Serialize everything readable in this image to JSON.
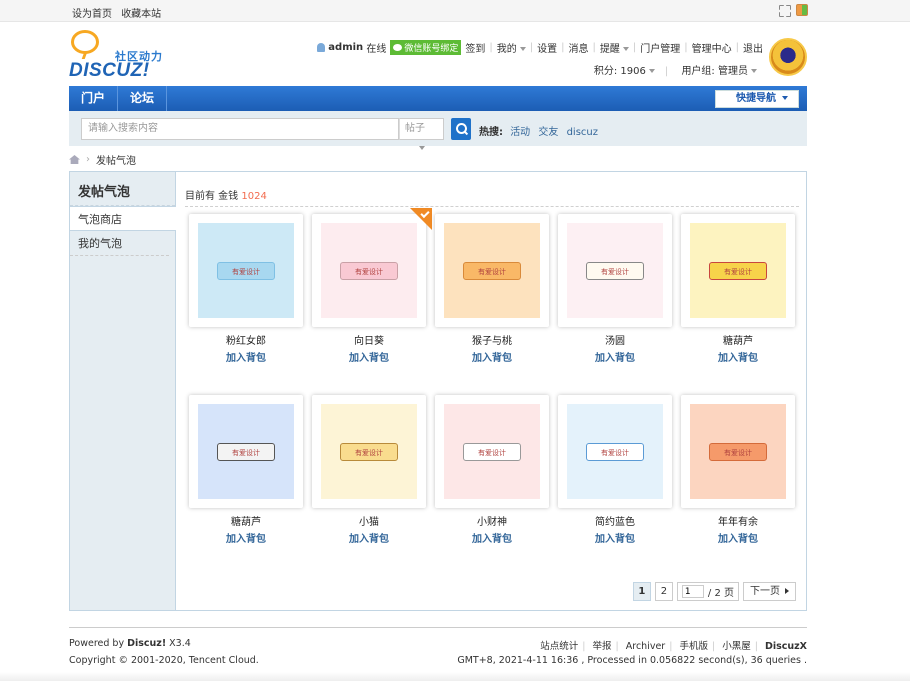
{
  "topbar": {
    "links": [
      "设为首页",
      "收藏本站"
    ]
  },
  "logo": {
    "cn": "社区动力",
    "en": "DISCUZ!"
  },
  "user": {
    "name": "admin",
    "online": "在线",
    "wechat": "微信账号绑定",
    "nav": [
      "签到",
      "我的",
      "设置",
      "消息",
      "提醒",
      "门户管理",
      "管理中心",
      "退出"
    ],
    "points": "积分: 1906",
    "group": "用户组: 管理员"
  },
  "nav": {
    "items": [
      "门户",
      "论坛"
    ],
    "quick": "快捷导航"
  },
  "search": {
    "placeholder": "请输入搜索内容",
    "type": "帖子",
    "hot_label": "热搜:",
    "hot": [
      "活动",
      "交友",
      "discuz"
    ]
  },
  "breadcrumb": {
    "current": "发帖气泡"
  },
  "sidebar": {
    "title": "发帖气泡",
    "items": [
      "气泡商店",
      "我的气泡"
    ]
  },
  "money": {
    "label": "目前有 金钱",
    "value": "1024"
  },
  "cards": [
    {
      "name": "粉红女郎",
      "bubble": "有爱设计",
      "action": "加入背包",
      "bg": "#cde9f6",
      "bcolor": "#a8d8f0",
      "bborder": "#7fc0e4"
    },
    {
      "name": "向日葵",
      "bubble": "有爱设计",
      "action": "加入背包",
      "bg": "#fdecef",
      "bcolor": "#f9c9d3",
      "bborder": "#c9a0a6"
    },
    {
      "name": "猴子与桃",
      "bubble": "有爱设计",
      "action": "加入背包",
      "bg": "#fde2be",
      "bcolor": "#f9b867",
      "bborder": "#d98a3a"
    },
    {
      "name": "汤圆",
      "bubble": "有爱设计",
      "action": "加入背包",
      "bg": "#fdf0f3",
      "bcolor": "#fffaf0",
      "bborder": "#888888"
    },
    {
      "name": "糖葫芦",
      "bubble": "有爱设计",
      "action": "加入背包",
      "bg": "#fdf3c0",
      "bcolor": "#f7d34a",
      "bborder": "#c9463d"
    },
    {
      "name": "糖葫芦",
      "bubble": "有爱设计",
      "action": "加入背包",
      "bg": "#d6e4fa",
      "bcolor": "#f3f3f3",
      "bborder": "#555555"
    },
    {
      "name": "小猫",
      "bubble": "有爱设计",
      "action": "加入背包",
      "bg": "#fdf4d6",
      "bcolor": "#f9dc8e",
      "bborder": "#b88a3a"
    },
    {
      "name": "小财神",
      "bubble": "有爱设计",
      "action": "加入背包",
      "bg": "#fde7e7",
      "bcolor": "#ffffff",
      "bborder": "#999999"
    },
    {
      "name": "简约蓝色",
      "bubble": "有爱设计",
      "action": "加入背包",
      "bg": "#e4f2fb",
      "bcolor": "#ffffff",
      "bborder": "#5b9bd5"
    },
    {
      "name": "年年有余",
      "bubble": "有爱设计",
      "action": "加入背包",
      "bg": "#fcd5c0",
      "bcolor": "#f59a6a",
      "bborder": "#d46b3a"
    }
  ],
  "pager": {
    "pages": [
      "1",
      "2"
    ],
    "current": "1",
    "jump_value": "1",
    "total": "/ 2 页",
    "next": "下一页"
  },
  "footer": {
    "powered_pre": "Powered by ",
    "powered_brand": "Discuz!",
    "powered_ver": " X3.4",
    "copyright": "Copyright © 2001-2020, Tencent Cloud.",
    "links": [
      "站点统计",
      "举报",
      "Archiver",
      "手机版",
      "小黑屋",
      "DiscuzX"
    ],
    "info": "GMT+8, 2021-4-11 16:36 , Processed in 0.056822 second(s), 36 queries ."
  }
}
